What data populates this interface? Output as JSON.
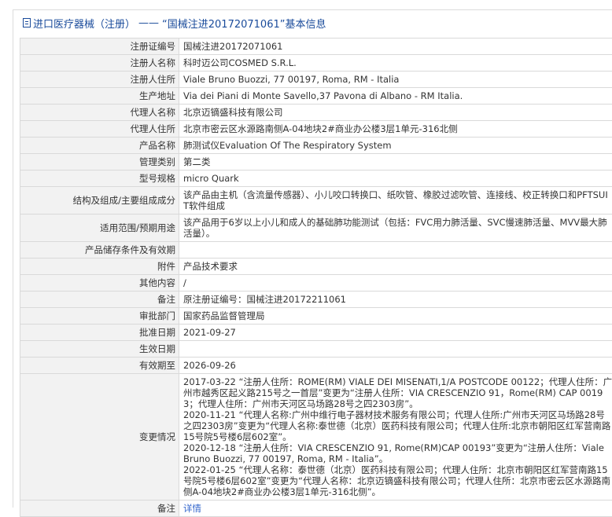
{
  "header": {
    "category": "进口医疗器械（注册）",
    "separator": "——",
    "record_title": "“国械注进20172071061”基本信息"
  },
  "rows": [
    {
      "label": "注册证编号",
      "value": "国械注进20172071061"
    },
    {
      "label": "注册人名称",
      "value": "科时迈公司COSMED S.R.L."
    },
    {
      "label": "注册人住所",
      "value": "Viale Bruno Buozzi, 77 00197, Roma, RM - Italia"
    },
    {
      "label": "生产地址",
      "value": "Via dei Piani di Monte Savello,37 Pavona di Albano - RM Italia."
    },
    {
      "label": "代理人名称",
      "value": "北京迈镝盛科技有限公司"
    },
    {
      "label": "代理人住所",
      "value": "北京市密云区水源路南侧A-04地块2#商业办公楼3层1单元-316北侧"
    },
    {
      "label": "产品名称",
      "value": "肺测试仪Evaluation Of The Respiratory System"
    },
    {
      "label": "管理类别",
      "value": "第二类"
    },
    {
      "label": "型号规格",
      "value": "micro Quark"
    },
    {
      "label": "结构及组成/主要组成成分",
      "value": "该产品由主机（含流量传感器）、小儿咬口转换口、纸吹管、橡胶过滤吹管、连接线、校正转换口和PFTSUIT软件组成"
    },
    {
      "label": "适用范围/预期用途",
      "value": "该产品用于6岁以上小儿和成人的基础肺功能测试（包括：FVC用力肺活量、SVC慢速肺活量、MVV最大肺活量）。"
    },
    {
      "label": "产品储存条件及有效期",
      "value": ""
    },
    {
      "label": "附件",
      "value": "产品技术要求"
    },
    {
      "label": "其他内容",
      "value": "/"
    },
    {
      "label": "备注",
      "value": "原注册证编号：国械注进20172211061"
    },
    {
      "label": "审批部门",
      "value": "国家药品监督管理局"
    },
    {
      "label": "批准日期",
      "value": "2021-09-27"
    },
    {
      "label": "生效日期",
      "value": ""
    },
    {
      "label": "有效期至",
      "value": "2026-09-26"
    }
  ],
  "changes": {
    "label": "变更情况",
    "entries": [
      "2017-03-22 “注册人住所：ROME(RM) VIALE DEI MISENATI,1/A POSTCODE 00122；代理人住所：广州市越秀区起义路215号之一首层”变更为“注册人住所：VIA CRESCENZIO 91，Rome(RM) CAP 00193；代理人住所：广州市天河区马场路28号之四2303房”。",
      "2020-11-21 “代理人名称:广州中维行电子器材技术服务有限公司；代理人住所:广州市天河区马场路28号之四2303房”变更为“代理人名称:泰世德（北京）医药科技有限公司；代理人住所:北京市朝阳区红军营南路15号院5号楼6层602室”。",
      "2020-12-18 “注册人住所：VIA CRESCENZIO 91, Rome(RM)CAP 00193”变更为“注册人住所：Viale Bruno Buozzi, 77 00197, Roma, RM - Italia”。",
      "2022-01-25 “代理人名称：泰世德（北京）医药科技有限公司；代理人住所：北京市朝阳区红军营南路15号院5号楼6层602室”变更为“代理人名称：北京迈镝盛科技有限公司；代理人住所：北京市密云区水源路南侧A-04地块2#商业办公楼3层1单元-316北侧”。"
    ]
  },
  "footer_row": {
    "label": "备注",
    "link": "详情"
  },
  "colors": {
    "title": "#1a4b9b",
    "label_bg": "#f2f2f2",
    "border": "#d9d9d9",
    "link": "#3366cc"
  }
}
